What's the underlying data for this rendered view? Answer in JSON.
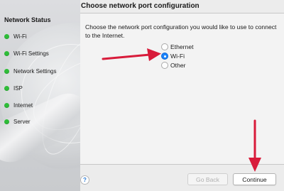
{
  "sidebar": {
    "title": "Network Status",
    "items": [
      {
        "label": "Wi-Fi",
        "status_color": "#2fbd39"
      },
      {
        "label": "Wi-Fi Settings",
        "status_color": "#2fbd39"
      },
      {
        "label": "Network Settings",
        "status_color": "#2fbd39"
      },
      {
        "label": "ISP",
        "status_color": "#2fbd39"
      },
      {
        "label": "Internet",
        "status_color": "#2fbd39"
      },
      {
        "label": "Server",
        "status_color": "#2fbd39"
      }
    ]
  },
  "main": {
    "title": "Choose network port configuration",
    "question": "Choose the network port configuration you would like to use to connect to the Internet.",
    "options": [
      {
        "label": "Ethernet",
        "selected": false
      },
      {
        "label": "Wi-Fi",
        "selected": true
      },
      {
        "label": "Other",
        "selected": false
      }
    ]
  },
  "footer": {
    "help_label": "?",
    "back_label": "Go Back",
    "back_enabled": false,
    "continue_label": "Continue"
  },
  "annotations": {
    "arrow_color": "#d81b3a"
  }
}
